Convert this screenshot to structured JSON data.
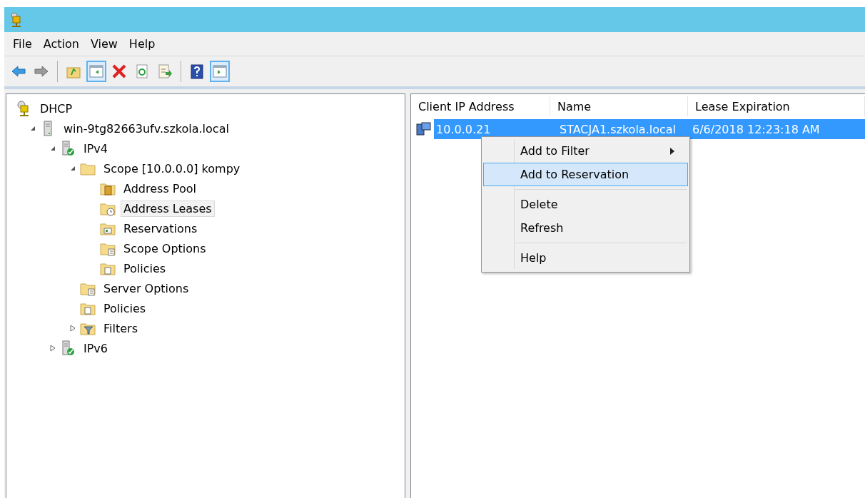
{
  "menu_bar": [
    "File",
    "Action",
    "View",
    "Help"
  ],
  "toolbar": [
    {
      "kind": "back",
      "pressed": false,
      "disabled": false
    },
    {
      "kind": "forward",
      "pressed": false,
      "disabled": true
    },
    {
      "kind": "separator"
    },
    {
      "kind": "up",
      "pressed": false,
      "disabled": false
    },
    {
      "kind": "tree-toggle",
      "pressed": true,
      "disabled": false
    },
    {
      "kind": "delete",
      "pressed": false,
      "disabled": false
    },
    {
      "kind": "refresh",
      "pressed": false,
      "disabled": false
    },
    {
      "kind": "export",
      "pressed": false,
      "disabled": false
    },
    {
      "kind": "separator"
    },
    {
      "kind": "help",
      "pressed": false,
      "disabled": false
    },
    {
      "kind": "action-pane",
      "pressed": true,
      "disabled": false
    }
  ],
  "tree": [
    {
      "label": "DHCP",
      "kind": "dhcp",
      "selected": false,
      "children": [
        {
          "label": "win-9tg82663ufv.szkola.local",
          "kind": "server",
          "expanded": true,
          "selected": false,
          "children": [
            {
              "label": "IPv4",
              "kind": "ip",
              "expanded": true,
              "selected": false,
              "children": [
                {
                  "label": "Scope [10.0.0.0] kompy",
                  "kind": "folder",
                  "expanded": true,
                  "selected": false,
                  "children": [
                    {
                      "label": "Address Pool",
                      "kind": "pool",
                      "selected": false
                    },
                    {
                      "label": "Address Leases",
                      "kind": "leases",
                      "selected": true
                    },
                    {
                      "label": "Reservations",
                      "kind": "reservations",
                      "selected": false
                    },
                    {
                      "label": "Scope Options",
                      "kind": "options",
                      "selected": false
                    },
                    {
                      "label": "Policies",
                      "kind": "policies",
                      "selected": false
                    }
                  ]
                },
                {
                  "label": "Server Options",
                  "kind": "options",
                  "selected": false
                },
                {
                  "label": "Policies",
                  "kind": "policies",
                  "selected": false
                },
                {
                  "label": "Filters",
                  "kind": "filters",
                  "expanded": false,
                  "selected": false
                }
              ]
            },
            {
              "label": "IPv6",
              "kind": "ip",
              "expanded": false,
              "selected": false
            }
          ]
        }
      ]
    }
  ],
  "table": {
    "columns": [
      "Client IP Address",
      "Name",
      "Lease Expiration"
    ],
    "rows": [
      {
        "cells": [
          "10.0.0.21",
          "STACJA1.szkola.local",
          "6/6/2018 12:23:18 AM"
        ],
        "selected": true
      }
    ]
  },
  "context_menu": [
    {
      "kind": "item",
      "label": "Add to Filter",
      "submenu": true,
      "selected": false
    },
    {
      "kind": "item",
      "label": "Add to Reservation",
      "submenu": false,
      "selected": true
    },
    {
      "kind": "separator"
    },
    {
      "kind": "item",
      "label": "Delete",
      "submenu": false,
      "selected": false
    },
    {
      "kind": "item",
      "label": "Refresh",
      "submenu": false,
      "selected": false
    },
    {
      "kind": "separator"
    },
    {
      "kind": "item",
      "label": "Help",
      "submenu": false,
      "selected": false
    }
  ]
}
